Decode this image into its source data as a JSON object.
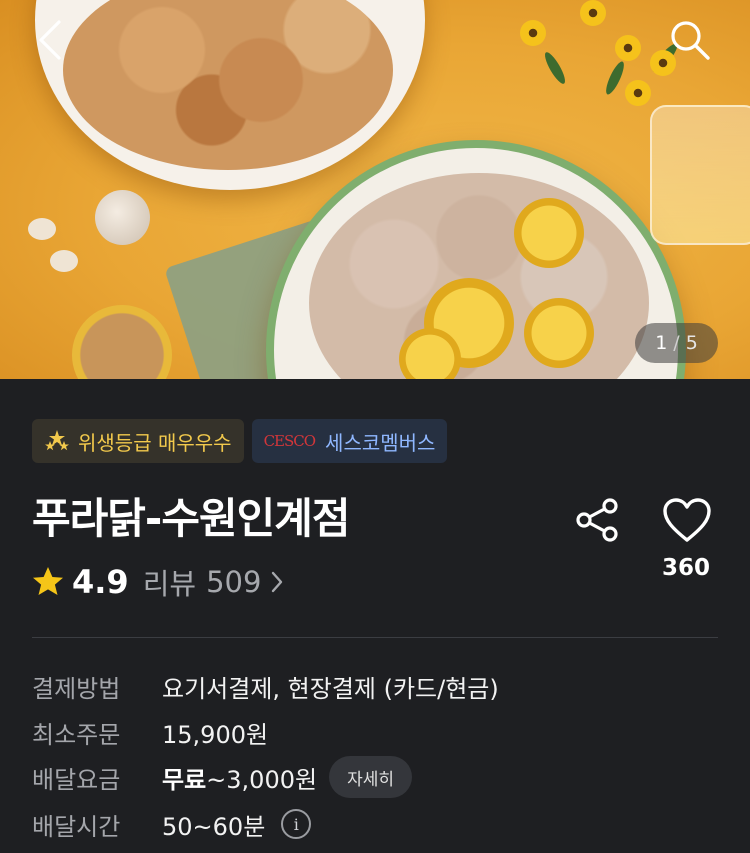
{
  "hero": {
    "page_current": "1",
    "page_separator": "/",
    "page_total": "5",
    "back_icon": "chevron-left-icon",
    "search_icon": "search-icon"
  },
  "badges": {
    "hygiene_label": "위생등급 매우우수",
    "hygiene_icon": "stars-icon",
    "cesco_logo": "CESCO",
    "cesco_label": "세스코멤버스"
  },
  "store": {
    "name": "푸라닭-수원인계점",
    "rating": "4.9",
    "review_label": "리뷰",
    "review_count": "509",
    "like_count": "360"
  },
  "info": {
    "payment_label": "결제방법",
    "payment_value": "요기서결제, 현장결제 (카드/현금)",
    "min_order_label": "최소주문",
    "min_order_value": "15,900원",
    "delivery_fee_label": "배달요금",
    "delivery_fee_free": "무료",
    "delivery_fee_range": "~3,000원",
    "delivery_fee_detail": "자세히",
    "delivery_time_label": "배달시간",
    "delivery_time_value": "50~60분",
    "info_icon_glyph": "i"
  },
  "colors": {
    "background": "#1e1f22",
    "star": "#f5c518",
    "hygiene_badge_text": "#f2c94c",
    "cesco_badge_text": "#8fb7ff",
    "cesco_logo": "#d2363a"
  }
}
